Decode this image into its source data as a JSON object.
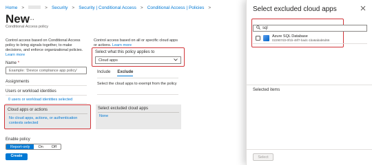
{
  "breadcrumb": {
    "items": [
      "Home",
      "Security",
      "Security | Conditional Access",
      "Conditional Access | Policies"
    ],
    "separator": ">"
  },
  "header": {
    "title": "New",
    "more_label": "...",
    "subtitle": "Conditional Access policy"
  },
  "left": {
    "description": "Control access based on Conditional Access policy to bring signals together, to make decisions, and enforce organizational policies.",
    "learn_more": "Learn more",
    "name_label": "Name",
    "required_mark": "*",
    "name_placeholder": "Example: 'Device compliance app policy'",
    "assignments_label": "Assignments",
    "users_label": "Users or workload identities",
    "users_value": "0 users or workload identities selected",
    "cloud_apps_label": "Cloud apps or actions",
    "cloud_apps_value": "No cloud apps, actions, or authentication contexts selected",
    "enable_policy_label": "Enable policy",
    "toggle_options": [
      "Report-only",
      "On",
      "Off"
    ],
    "create_label": "Create"
  },
  "middle": {
    "description": "Control access based on all or specific cloud apps or actions.",
    "learn_more": "Learn more",
    "select_label": "Select what this policy applies to",
    "select_value": "Cloud apps",
    "tabs": [
      "Include",
      "Exclude"
    ],
    "exclude_desc": "Select the cloud apps to exempt from the policy",
    "excluded_label": "Select excluded cloud apps",
    "excluded_value": "None"
  },
  "panel": {
    "title": "Select excluded cloud apps",
    "search_value": "sql",
    "result": {
      "name": "Azure SQL Database",
      "id": "022907d3-0f1b-48f7-badc-1ba6abab6d66"
    },
    "selected_items_label": "Selected items",
    "select_button": "Select"
  },
  "colors": {
    "accent": "#0078d4",
    "highlight": "#d13438"
  }
}
